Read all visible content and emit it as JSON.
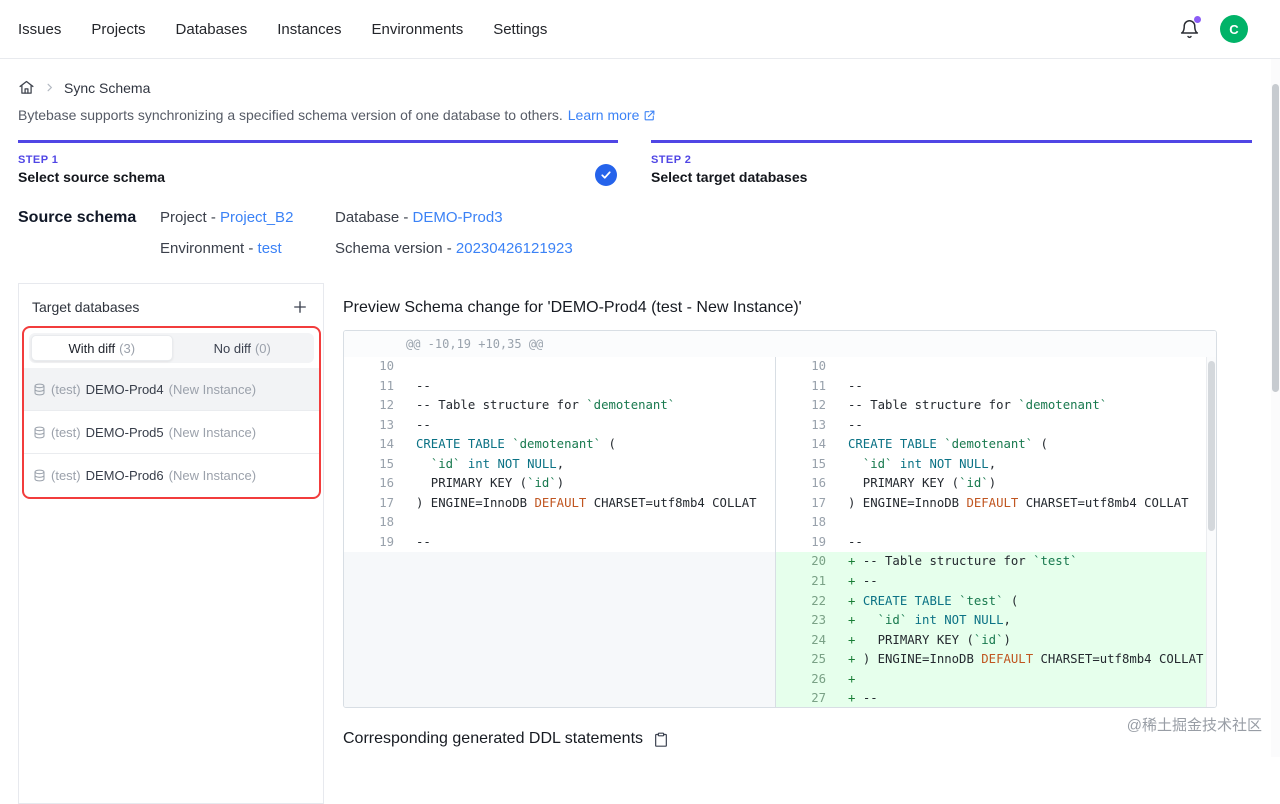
{
  "colors": {
    "accent": "#5046e5",
    "link": "#3b82f6",
    "highlight_red": "#f23c3c",
    "avatar_green": "#00b368",
    "check_blue": "#2563eb",
    "diff_add_bg": "#e6ffec"
  },
  "nav": {
    "items": [
      "Issues",
      "Projects",
      "Databases",
      "Instances",
      "Environments",
      "Settings"
    ],
    "avatar_letter": "C"
  },
  "breadcrumb": {
    "current": "Sync Schema"
  },
  "description": {
    "text": "Bytebase supports synchronizing a specified schema version of one database to others.",
    "link": "Learn more"
  },
  "steps": [
    {
      "step": "STEP 1",
      "label": "Select source schema",
      "completed": true
    },
    {
      "step": "STEP 2",
      "label": "Select target databases",
      "completed": false
    }
  ],
  "source_schema": {
    "label": "Source schema",
    "fields": [
      {
        "label": "Project -",
        "value": "Project_B2"
      },
      {
        "label": "Database -",
        "value": "DEMO-Prod3"
      },
      {
        "label": "Environment -",
        "value": "test"
      },
      {
        "label": "Schema version -",
        "value": "20230426121923"
      }
    ]
  },
  "target_panel": {
    "title": "Target databases",
    "tabs": [
      {
        "label": "With diff",
        "count": "(3)",
        "active": true
      },
      {
        "label": "No diff",
        "count": "(0)",
        "active": false
      }
    ],
    "items": [
      {
        "env": "(test)",
        "name": "DEMO-Prod4",
        "suffix": "(New Instance)",
        "selected": true
      },
      {
        "env": "(test)",
        "name": "DEMO-Prod5",
        "suffix": "(New Instance)",
        "selected": false
      },
      {
        "env": "(test)",
        "name": "DEMO-Prod6",
        "suffix": "(New Instance)",
        "selected": false
      }
    ]
  },
  "preview": {
    "title": "Preview Schema change for 'DEMO-Prod4 (test - New Instance)'",
    "diff_header": "@@ -10,19 +10,35 @@",
    "left_rows": [
      {
        "num": "10",
        "segs": []
      },
      {
        "num": "11",
        "segs": [
          [
            "--",
            "p"
          ]
        ]
      },
      {
        "num": "12",
        "segs": [
          [
            "-- Table structure for ",
            "p"
          ],
          [
            "`demotenant`",
            "s"
          ]
        ]
      },
      {
        "num": "13",
        "segs": [
          [
            "--",
            "p"
          ]
        ]
      },
      {
        "num": "14",
        "segs": [
          [
            "CREATE TABLE",
            "k"
          ],
          [
            " ",
            "p"
          ],
          [
            "`demotenant`",
            "s"
          ],
          [
            " (",
            "p"
          ]
        ]
      },
      {
        "num": "15",
        "segs": [
          [
            "  ",
            "p"
          ],
          [
            "`id`",
            "s"
          ],
          [
            " ",
            "p"
          ],
          [
            "int",
            "k"
          ],
          [
            " ",
            "p"
          ],
          [
            "NOT NULL",
            "k"
          ],
          [
            ",",
            "p"
          ]
        ]
      },
      {
        "num": "16",
        "segs": [
          [
            "  PRIMARY KEY (",
            "p"
          ],
          [
            "`id`",
            "s"
          ],
          [
            ")",
            "p"
          ]
        ]
      },
      {
        "num": "17",
        "segs": [
          [
            ") ENGINE=InnoDB ",
            "p"
          ],
          [
            "DEFAULT",
            "o"
          ],
          [
            " CHARSET=utf8mb4 ",
            "p"
          ],
          [
            "COLLAT",
            "p"
          ]
        ]
      },
      {
        "num": "18",
        "segs": []
      },
      {
        "num": "19",
        "segs": [
          [
            "--",
            "p"
          ]
        ]
      },
      {
        "filler": true
      },
      {
        "filler": true
      },
      {
        "filler": true
      },
      {
        "filler": true
      },
      {
        "filler": true
      },
      {
        "filler": true
      },
      {
        "filler": true
      },
      {
        "filler": true
      }
    ],
    "right_rows": [
      {
        "num": "10",
        "segs": []
      },
      {
        "num": "11",
        "segs": [
          [
            "--",
            "p"
          ]
        ]
      },
      {
        "num": "12",
        "segs": [
          [
            "-- Table structure for ",
            "p"
          ],
          [
            "`demotenant`",
            "s"
          ]
        ]
      },
      {
        "num": "13",
        "segs": [
          [
            "--",
            "p"
          ]
        ]
      },
      {
        "num": "14",
        "segs": [
          [
            "CREATE TABLE",
            "k"
          ],
          [
            " ",
            "p"
          ],
          [
            "`demotenant`",
            "s"
          ],
          [
            " (",
            "p"
          ]
        ]
      },
      {
        "num": "15",
        "segs": [
          [
            "  ",
            "p"
          ],
          [
            "`id`",
            "s"
          ],
          [
            " ",
            "p"
          ],
          [
            "int",
            "k"
          ],
          [
            " ",
            "p"
          ],
          [
            "NOT NULL",
            "k"
          ],
          [
            ",",
            "p"
          ]
        ]
      },
      {
        "num": "16",
        "segs": [
          [
            "  PRIMARY KEY (",
            "p"
          ],
          [
            "`id`",
            "s"
          ],
          [
            ")",
            "p"
          ]
        ]
      },
      {
        "num": "17",
        "segs": [
          [
            ") ENGINE=InnoDB ",
            "p"
          ],
          [
            "DEFAULT",
            "o"
          ],
          [
            " CHARSET=utf8mb4 ",
            "p"
          ],
          [
            "COLLAT",
            "p"
          ]
        ]
      },
      {
        "num": "18",
        "segs": []
      },
      {
        "num": "19",
        "segs": [
          [
            "--",
            "p"
          ]
        ]
      },
      {
        "num": "20",
        "add": true,
        "segs": [
          [
            "-- Table structure for ",
            "p"
          ],
          [
            "`test`",
            "s"
          ]
        ]
      },
      {
        "num": "21",
        "add": true,
        "segs": [
          [
            "--",
            "p"
          ]
        ]
      },
      {
        "num": "22",
        "add": true,
        "segs": [
          [
            "CREATE TABLE",
            "k"
          ],
          [
            " ",
            "p"
          ],
          [
            "`test`",
            "s"
          ],
          [
            " (",
            "p"
          ]
        ]
      },
      {
        "num": "23",
        "add": true,
        "segs": [
          [
            "  ",
            "p"
          ],
          [
            "`id`",
            "s"
          ],
          [
            " ",
            "p"
          ],
          [
            "int",
            "k"
          ],
          [
            " ",
            "p"
          ],
          [
            "NOT NULL",
            "k"
          ],
          [
            ",",
            "p"
          ]
        ]
      },
      {
        "num": "24",
        "add": true,
        "segs": [
          [
            "  PRIMARY KEY (",
            "p"
          ],
          [
            "`id`",
            "s"
          ],
          [
            ")",
            "p"
          ]
        ]
      },
      {
        "num": "25",
        "add": true,
        "segs": [
          [
            ") ENGINE=InnoDB ",
            "p"
          ],
          [
            "DEFAULT",
            "o"
          ],
          [
            " CHARSET=utf8mb4 ",
            "p"
          ],
          [
            "COLLAT",
            "p"
          ]
        ]
      },
      {
        "num": "26",
        "add": true,
        "segs": []
      },
      {
        "num": "27",
        "add": true,
        "segs": [
          [
            "--",
            "p"
          ]
        ]
      }
    ]
  },
  "ddl": {
    "title": "Corresponding generated DDL statements"
  },
  "watermark": "@稀土掘金技术社区"
}
